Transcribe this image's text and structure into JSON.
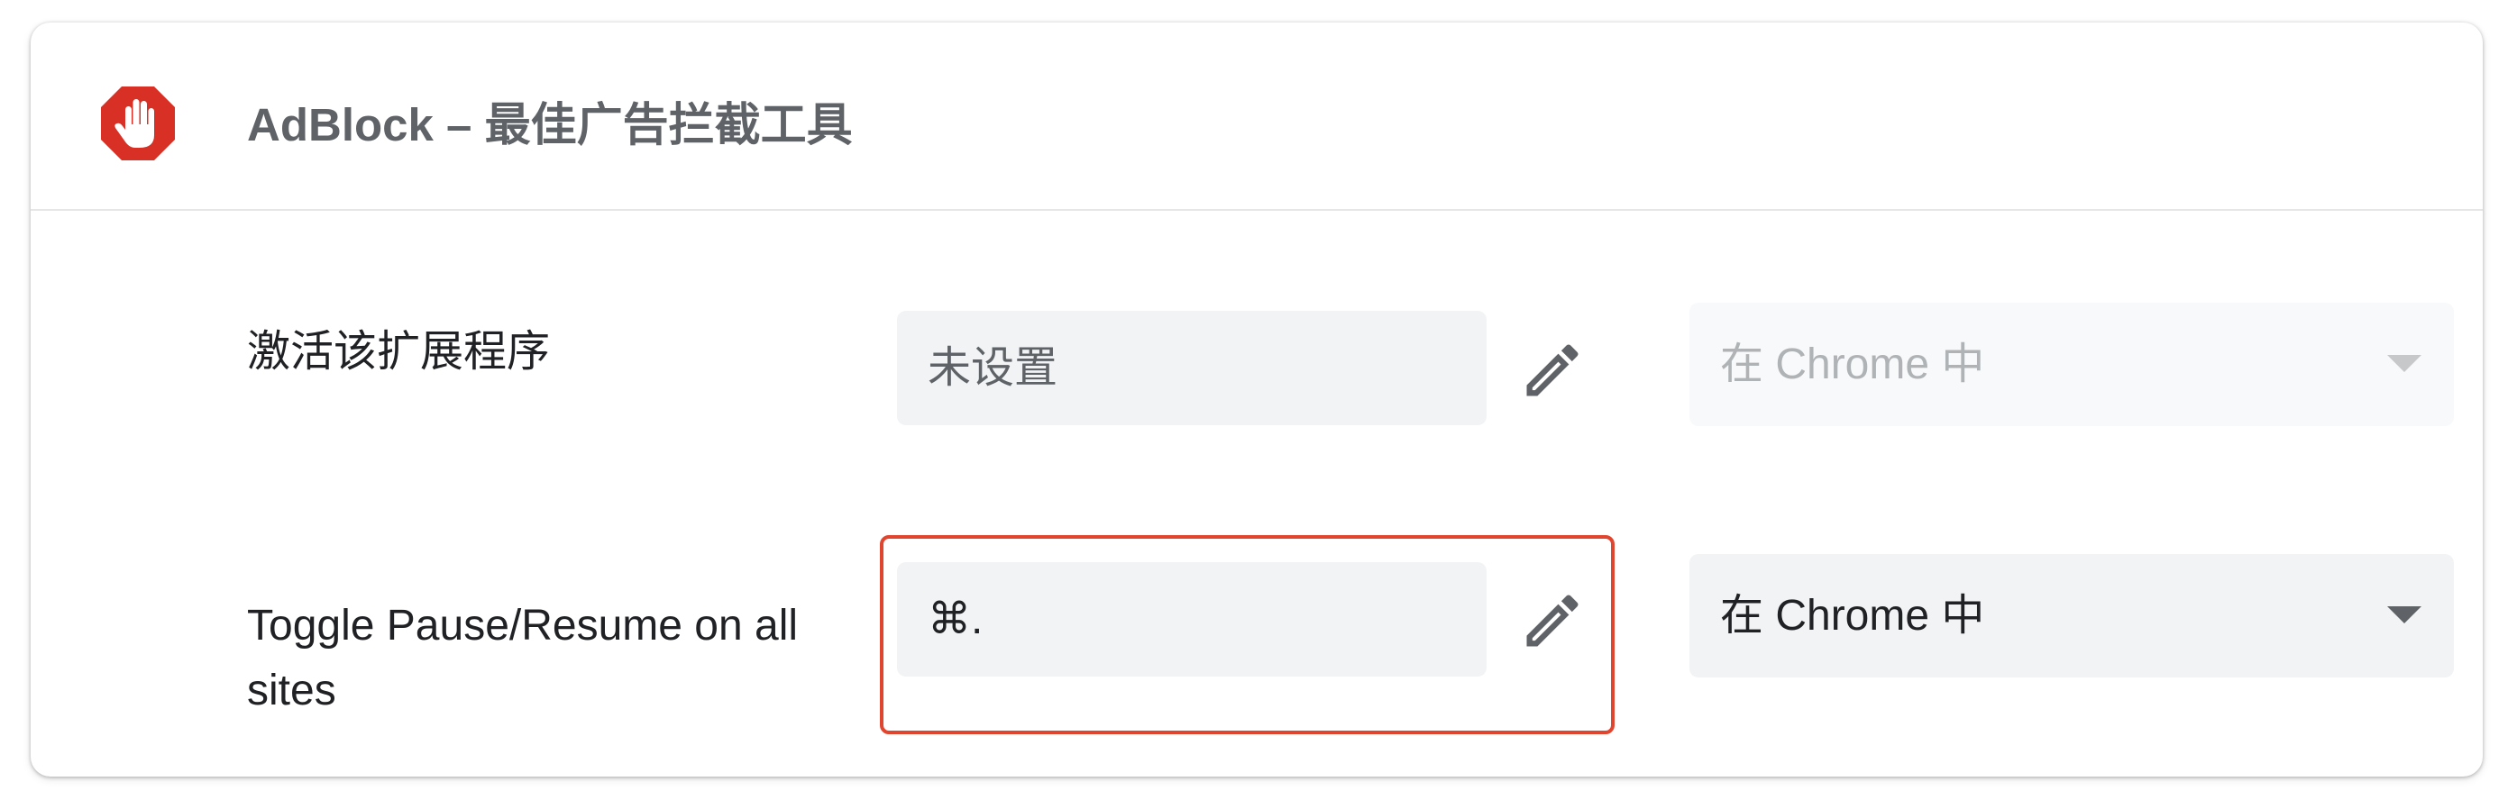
{
  "extension": {
    "title": "AdBlock – 最佳广告拦截工具",
    "icon": "adblock-hand-icon",
    "icon_color": "#d93025"
  },
  "shortcuts": [
    {
      "label": "激活该扩展程序",
      "value": "未设置",
      "scope": "在 Chrome 中",
      "scope_enabled": false
    },
    {
      "label": "Toggle Pause/Resume on all sites",
      "value": "⌘.",
      "scope": "在 Chrome 中",
      "scope_enabled": true
    }
  ],
  "colors": {
    "highlight": "#e0452f",
    "field_bg": "#f1f3f4",
    "text_primary": "#202124",
    "text_secondary": "#5f6368"
  }
}
